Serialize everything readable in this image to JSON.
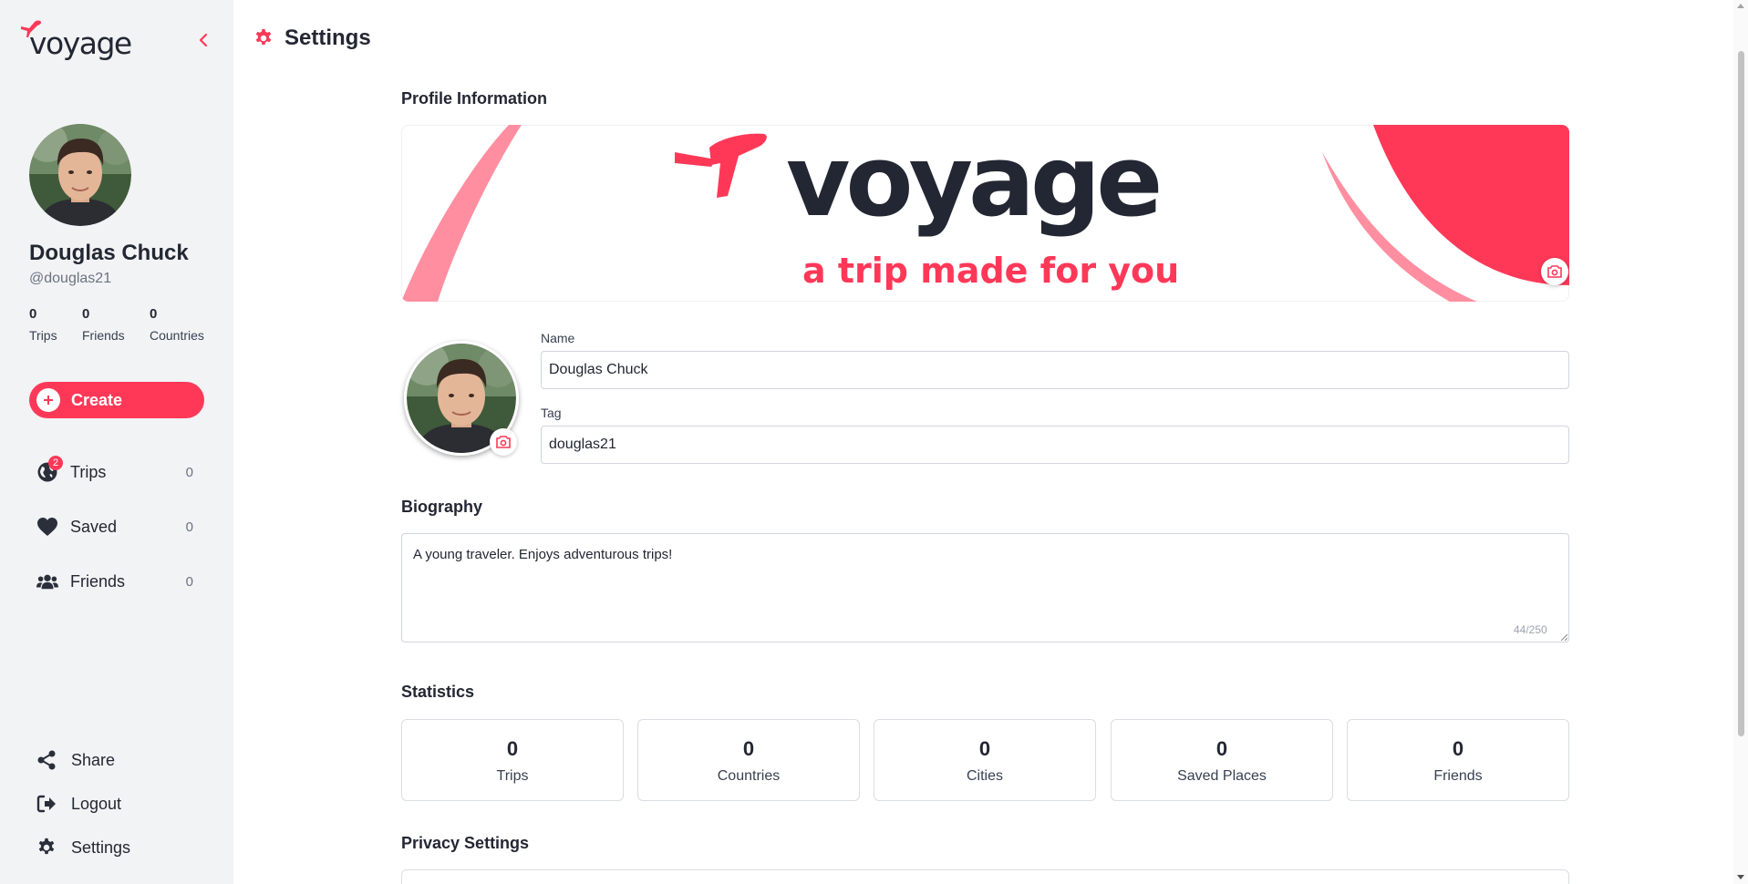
{
  "app": {
    "logo_text": "voyage"
  },
  "colors": {
    "accent": "#ff3858",
    "dark": "#232733",
    "sidebar_bg": "#f2f3f5"
  },
  "sidebar": {
    "user_name": "Douglas Chuck",
    "user_tag": "@douglas21",
    "stats": [
      {
        "value": "0",
        "label": "Trips"
      },
      {
        "value": "0",
        "label": "Friends"
      },
      {
        "value": "0",
        "label": "Countries"
      }
    ],
    "create_label": "Create",
    "nav": [
      {
        "label": "Trips",
        "count": "0",
        "icon": "globe-icon",
        "badge": "2"
      },
      {
        "label": "Saved",
        "count": "0",
        "icon": "heart-icon"
      },
      {
        "label": "Friends",
        "count": "0",
        "icon": "users-icon"
      }
    ],
    "bottom": [
      {
        "label": "Share",
        "icon": "share-icon"
      },
      {
        "label": "Logout",
        "icon": "logout-icon"
      },
      {
        "label": "Settings",
        "icon": "gear-icon"
      }
    ]
  },
  "header": {
    "title": "Settings"
  },
  "profile": {
    "section_title": "Profile Information",
    "banner": {
      "logo_text": "voyage",
      "tagline": "a trip made for you"
    },
    "name_label": "Name",
    "name_value": "Douglas Chuck",
    "tag_label": "Tag",
    "tag_value": "douglas21"
  },
  "biography": {
    "title": "Biography",
    "text": "A young traveler. Enjoys adventurous trips!",
    "counter": "44/250"
  },
  "statistics": {
    "title": "Statistics",
    "cards": [
      {
        "value": "0",
        "label": "Trips"
      },
      {
        "value": "0",
        "label": "Countries"
      },
      {
        "value": "0",
        "label": "Cities"
      },
      {
        "value": "0",
        "label": "Saved Places"
      },
      {
        "value": "0",
        "label": "Friends"
      }
    ]
  },
  "privacy": {
    "title": "Privacy Settings"
  }
}
